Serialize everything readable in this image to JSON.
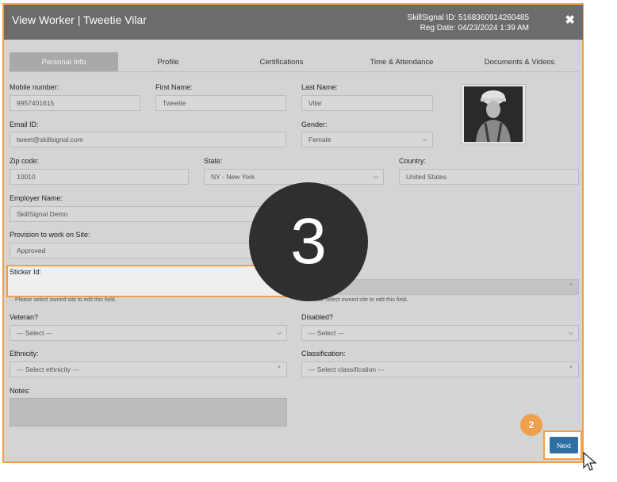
{
  "header": {
    "title": "View Worker | Tweetie Vilar",
    "skillsignal_id": "SkillSignal ID: 5168360914260485",
    "reg_date": "Reg Date: 04/23/2024 1:39 AM",
    "close_glyph": "✖"
  },
  "tabs": [
    {
      "label": "Personal Info"
    },
    {
      "label": "Profile"
    },
    {
      "label": "Certifications"
    },
    {
      "label": "Time & Attendance"
    },
    {
      "label": "Documents & Videos"
    }
  ],
  "form": {
    "mobile_label": "Mobile number:",
    "mobile_value": "9957401615",
    "first_label": "First Name:",
    "first_value": "Tweetie",
    "last_label": "Last Name:",
    "last_value": "Vilar",
    "email_label": "Email ID:",
    "email_value": "tweet@skillsignal.com",
    "gender_label": "Gender:",
    "gender_value": "Female",
    "zip_label": "Zip code:",
    "zip_value": "10010",
    "state_label": "State:",
    "state_value": "NY - New York",
    "country_label": "Country:",
    "country_value": "United States",
    "employer_label": "Employer Name:",
    "employer_value": "SkillSignal Demo",
    "provision_label": "Provision to work on Site:",
    "provision_value": "Approved",
    "sticker_label": "Sticker Id:",
    "hint_text": "Please select owned site to edit this field.",
    "veteran_label": "Veteran?",
    "veteran_value": "--- Select ---",
    "disabled_label": "Disabled?",
    "disabled_value": "--- Select ---",
    "ethnicity_label": "Ethnicity:",
    "ethnicity_value": "--- Select ethnicity ---",
    "classification_label": "Classification:",
    "classification_value": "--- Select classification ---",
    "notes_label": "Notes:"
  },
  "overlay": {
    "step3": "3",
    "step2": "2"
  },
  "buttons": {
    "next": "Next"
  }
}
